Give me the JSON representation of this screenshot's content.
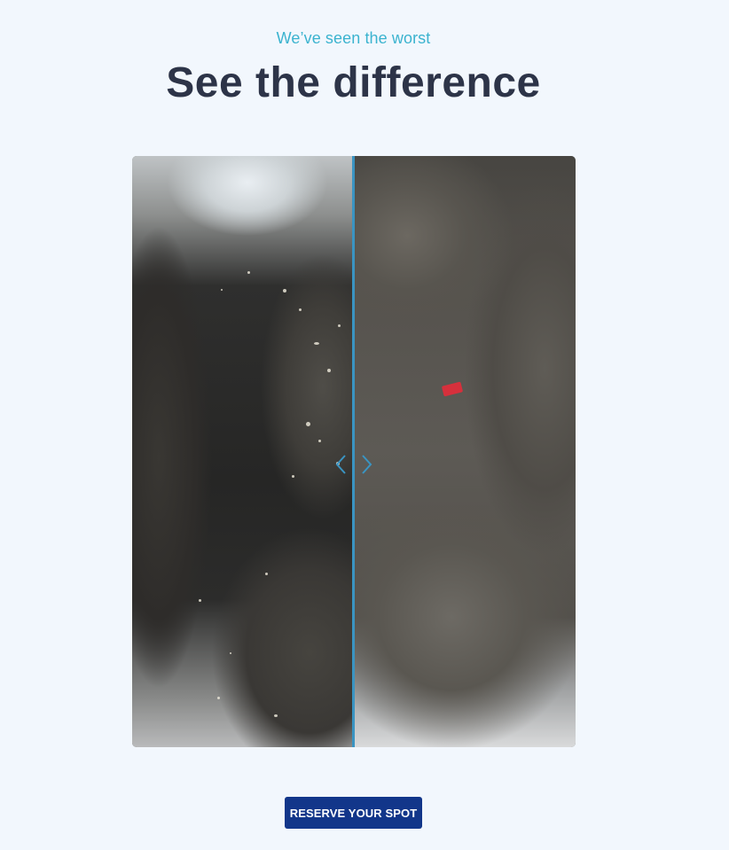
{
  "header": {
    "eyebrow": "We’ve seen the worst",
    "title": "See the difference"
  },
  "comparison": {
    "before_image": "dirty-car-interior-photo",
    "after_image": "clean-car-interior-photo",
    "handle_icon": "chevron-left-right-icon",
    "divider_color": "#3a94c2",
    "split_fraction": 0.5
  },
  "cta": {
    "label": "RESERVE YOUR SPOT",
    "color": "#12368a"
  },
  "colors": {
    "background": "#f2f7fd",
    "eyebrow": "#3bb3cf",
    "title": "#2d3448"
  }
}
